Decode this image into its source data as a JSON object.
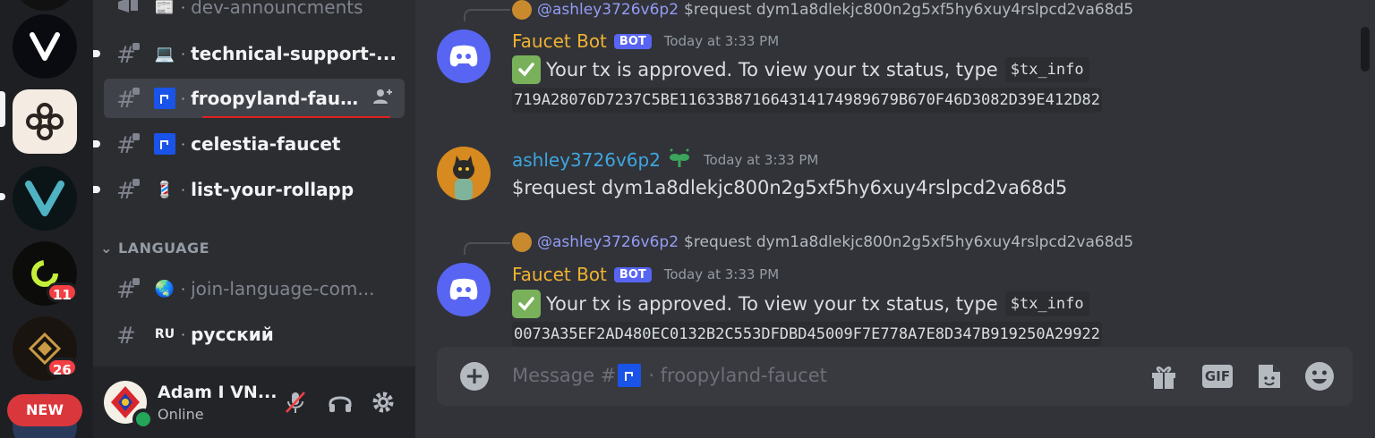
{
  "server_rail": {
    "badges": [
      "11",
      "26"
    ],
    "new_label": "NEW"
  },
  "channels": {
    "items": [
      {
        "label": "dev-announcments",
        "emoji": "📰"
      },
      {
        "label": "technical-support-...",
        "emoji": "💻"
      },
      {
        "label": "froopyland-fauc...",
        "emoji": "🚰"
      },
      {
        "label": "celestia-faucet",
        "emoji": "🚰"
      },
      {
        "label": "list-your-rollapp",
        "emoji": "💈"
      },
      {
        "label": "join-language-com...",
        "emoji": "🌏"
      },
      {
        "label": "русский",
        "emoji": "RU"
      }
    ],
    "category": "LANGUAGE"
  },
  "user_panel": {
    "name": "Adam I VN...",
    "status": "Online"
  },
  "messages": [
    {
      "reply_user": "@ashley3726v6p2",
      "reply_text": "$request dym1a8dlekjc800n2g5xf5hy6xuy4rslpcd2va68d5",
      "author": "Faucet Bot",
      "bot_tag": "BOT",
      "time": "Today at 3:33 PM",
      "text": "Your tx is approved. To view your tx status, type",
      "command": "$tx_info",
      "hash": "719A28076D7237C5BE11633B871664314174989679B670F46D3082D39E412D82"
    },
    {
      "author": "ashley3726v6p2",
      "time": "Today at 3:33 PM",
      "text": "$request dym1a8dlekjc800n2g5xf5hy6xuy4rslpcd2va68d5"
    },
    {
      "reply_user": "@ashley3726v6p2",
      "reply_text": "$request dym1a8dlekjc800n2g5xf5hy6xuy4rslpcd2va68d5",
      "author": "Faucet Bot",
      "bot_tag": "BOT",
      "time": "Today at 3:33 PM",
      "text": "Your tx is approved. To view your tx status, type",
      "command": "$tx_info",
      "hash": "0073A35EF2AD480EC0132B2C553DFDBD45009F7E778A7E8D347B919250A29922"
    }
  ],
  "composer": {
    "prefix": "Message #",
    "channel": "· froopyland-faucet",
    "gif_label": "GIF"
  },
  "colors": {
    "bot_name": "#f0b232",
    "user_name": "#3ea6e0",
    "accent": "#5865f2"
  }
}
